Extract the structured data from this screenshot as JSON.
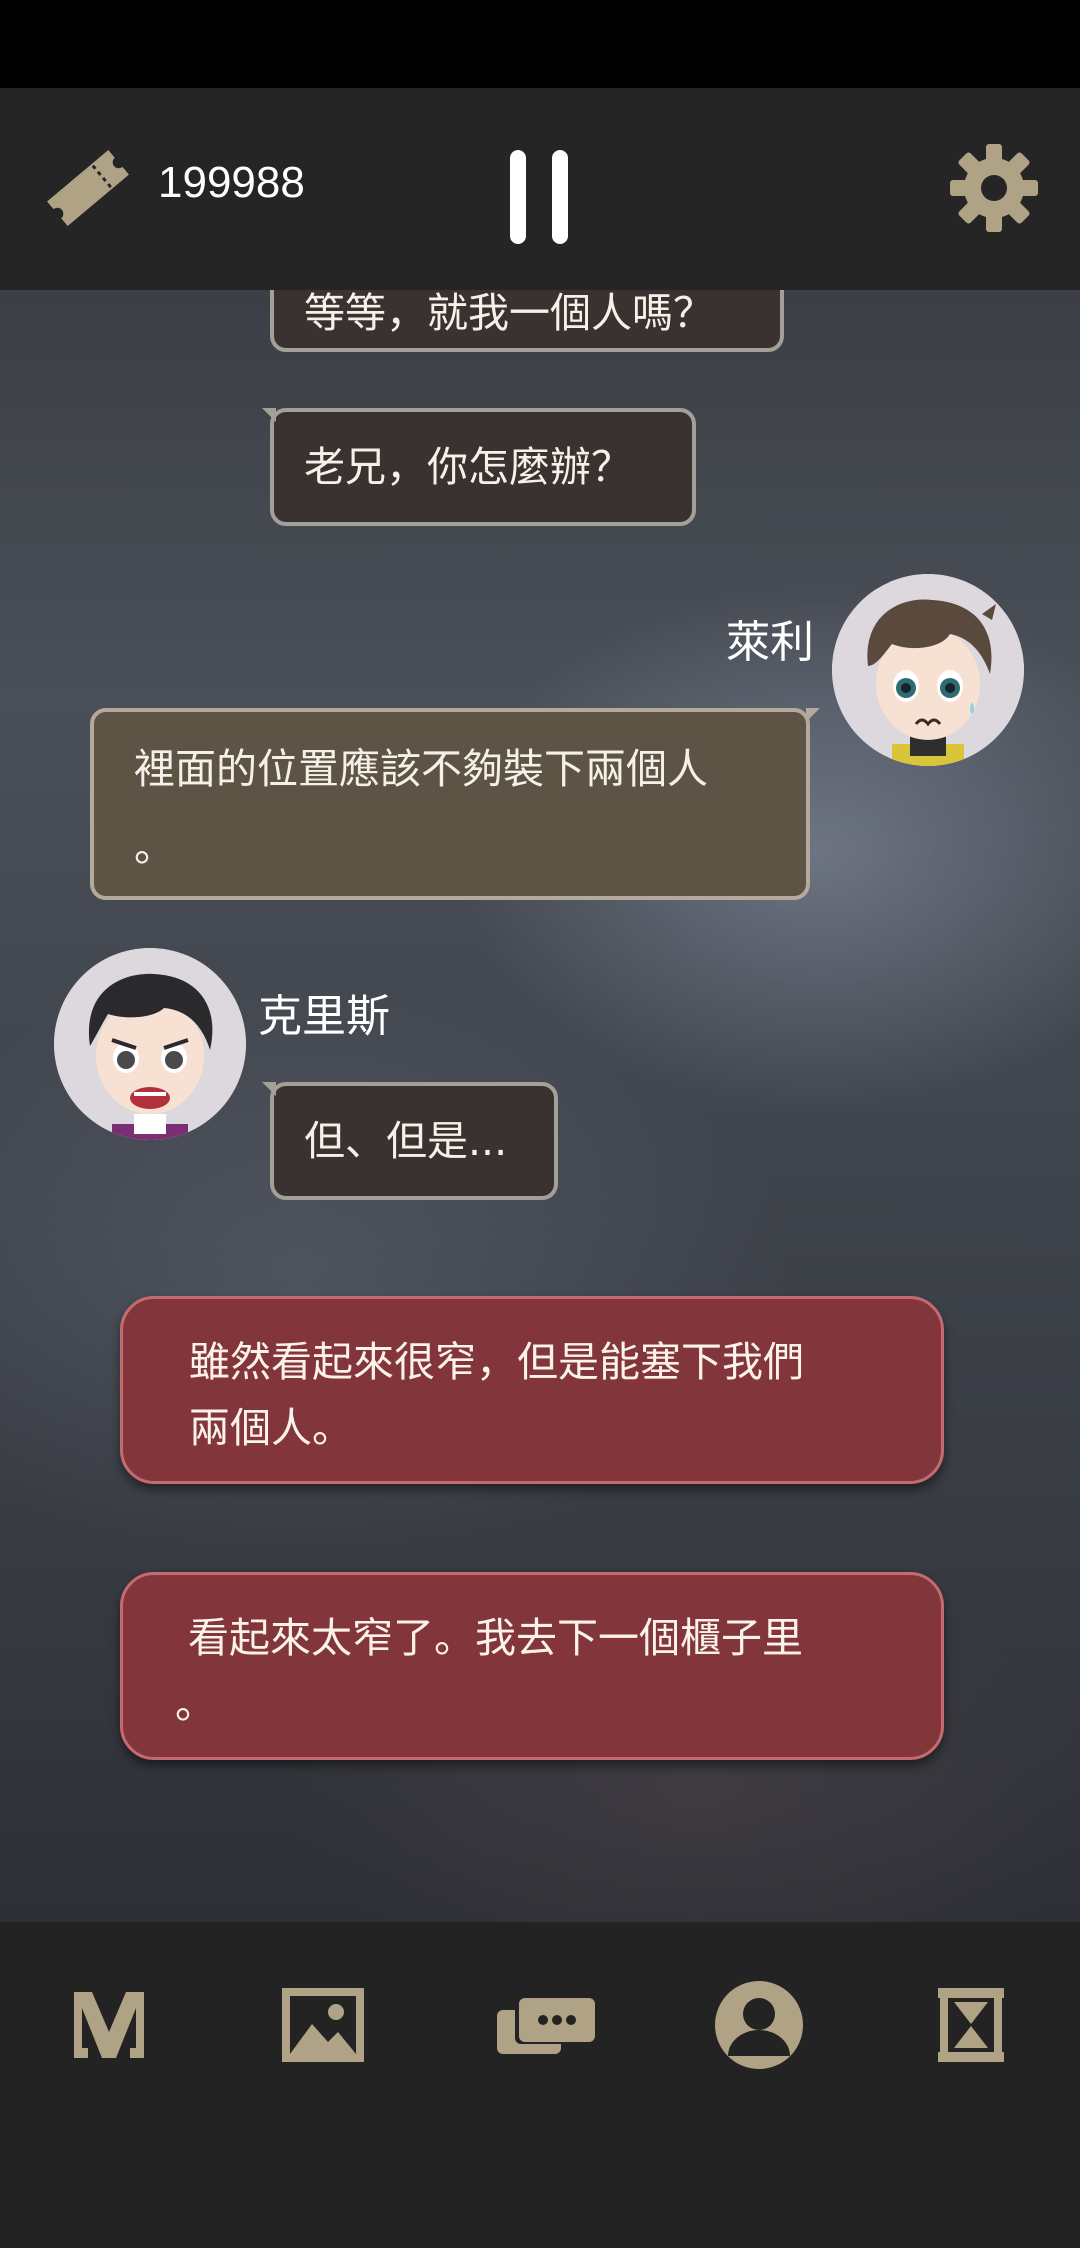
{
  "header": {
    "ticket_count": "199988",
    "icons": {
      "ticket": "ticket-icon",
      "pause": "pause-icon",
      "settings": "gear-icon"
    }
  },
  "messages": [
    {
      "speaker": "",
      "text": "等等，就我一個人嗎？",
      "style": "dark"
    },
    {
      "speaker": "",
      "text": "老兄，你怎麼辦？",
      "style": "dark"
    },
    {
      "speaker": "萊利",
      "line1": "裡面的位置應該不夠裝下兩個人",
      "line2": "。",
      "style": "olive"
    },
    {
      "speaker": "克里斯",
      "text": "但、但是...",
      "style": "dark"
    }
  ],
  "choices": [
    {
      "line1": "雖然看起來很窄，但是能塞下我們",
      "line2": "兩個人。"
    },
    {
      "line1": " 看起來太窄了。我去下一個櫃子里",
      "line2": "。"
    }
  ],
  "bottom_nav": [
    "menu-m-icon",
    "gallery-image-icon",
    "chat-log-icon",
    "profile-icon",
    "hourglass-icon"
  ],
  "colors": {
    "choice_red": "#82353a",
    "bubble_dark": "#3a3230",
    "bubble_olive": "#5d5446",
    "icon_tan": "#b0a385"
  }
}
